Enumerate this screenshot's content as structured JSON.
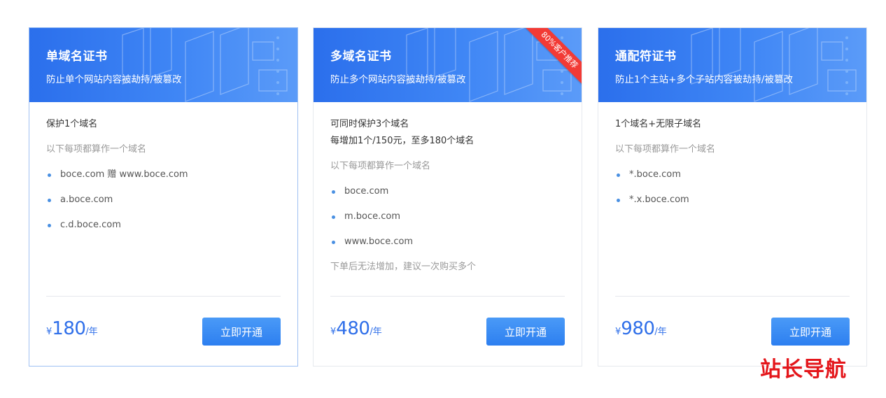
{
  "cards": [
    {
      "title": "单域名证书",
      "subtitle": "防止单个网站内容被劫持/被篡改",
      "lines": [
        "保护1个域名"
      ],
      "note": "以下每项都算作一个域名",
      "domains": [
        "boce.com 赠 www.boce.com",
        "a.boce.com",
        "c.d.boce.com"
      ],
      "warn": "",
      "currency": "¥",
      "amount": "180",
      "unit": "/年",
      "button": "立即开通"
    },
    {
      "title": "多域名证书",
      "subtitle": "防止多个网站内容被劫持/被篡改",
      "ribbon": "80%客户推荐",
      "lines": [
        "可同时保护3个域名",
        "每增加1个/150元，至多180个域名"
      ],
      "note": "以下每项都算作一个域名",
      "domains": [
        "boce.com",
        "m.boce.com",
        "www.boce.com"
      ],
      "warn": "下单后无法增加，建议一次购买多个",
      "currency": "¥",
      "amount": "480",
      "unit": "/年",
      "button": "立即开通"
    },
    {
      "title": "通配符证书",
      "subtitle": "防止1个主站+多个子站内容被劫持/被篡改",
      "lines": [
        "1个域名+无限子域名"
      ],
      "note": "以下每项都算作一个域名",
      "domains": [
        "*.boce.com",
        "*.x.boce.com"
      ],
      "warn": "",
      "currency": "¥",
      "amount": "980",
      "unit": "/年",
      "button": "立即开通"
    }
  ],
  "watermark": "站长导航",
  "colors": {
    "accent": "#2f6fe9",
    "header": "#2b6fec",
    "ribbon": "#f23a35",
    "watermark": "#e4161b"
  }
}
